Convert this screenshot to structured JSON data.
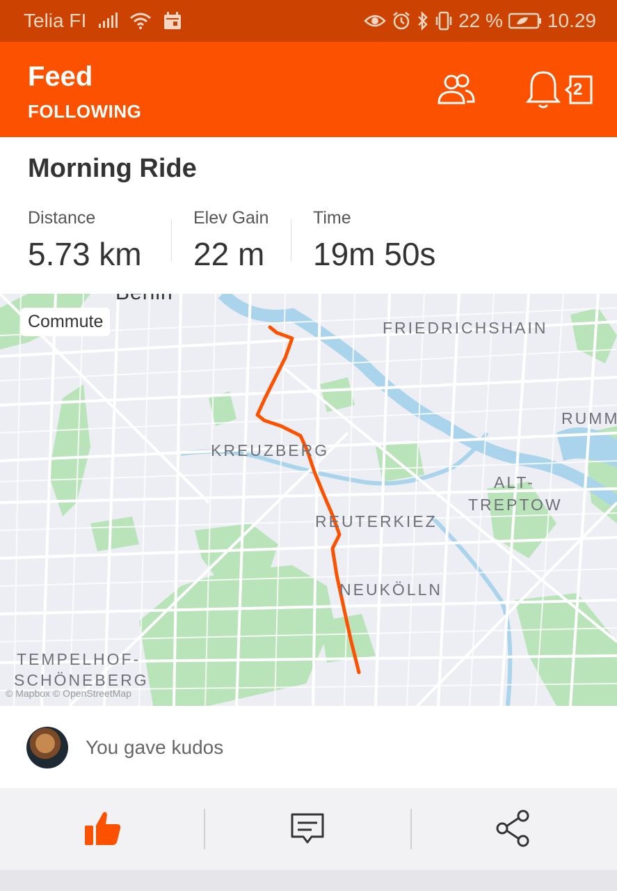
{
  "status_bar": {
    "carrier": "Telia FI",
    "battery": "22 %",
    "time": "10.29",
    "icons": [
      "signal-icon",
      "wifi-icon",
      "calendar-icon",
      "eye-icon",
      "alarm-icon",
      "bluetooth-icon",
      "vibrate-icon",
      "battery-icon"
    ]
  },
  "header": {
    "title": "Feed",
    "subtitle": "FOLLOWING",
    "notification_count": "2",
    "accent": "#fc5200"
  },
  "activity": {
    "title": "Morning Ride",
    "stats": [
      {
        "label": "Distance",
        "value": "5.73 km"
      },
      {
        "label": "Elev Gain",
        "value": "22 m"
      },
      {
        "label": "Time",
        "value": "19m 50s"
      }
    ],
    "tag": "Commute"
  },
  "map": {
    "labels": {
      "friedrichshain": "FRIEDRICHSHAIN",
      "kreuzberg": "KREUZBERG",
      "rumm": "RUMM",
      "alt": "ALT-",
      "treptow": "TREPTOW",
      "reuterkiez": "REUTERKIEZ",
      "neukolln": "NEUKÖLLN",
      "tempelhof": "TEMPELHOF-",
      "schoneberg": "SCHÖNEBERG",
      "berlin": "Berlin"
    },
    "attribution": "© Mapbox © OpenStreetMap",
    "route_color": "#fc5200"
  },
  "kudos": {
    "text": "You gave kudos"
  },
  "actions": [
    "kudos-thumb-icon",
    "comment-icon",
    "share-icon"
  ]
}
